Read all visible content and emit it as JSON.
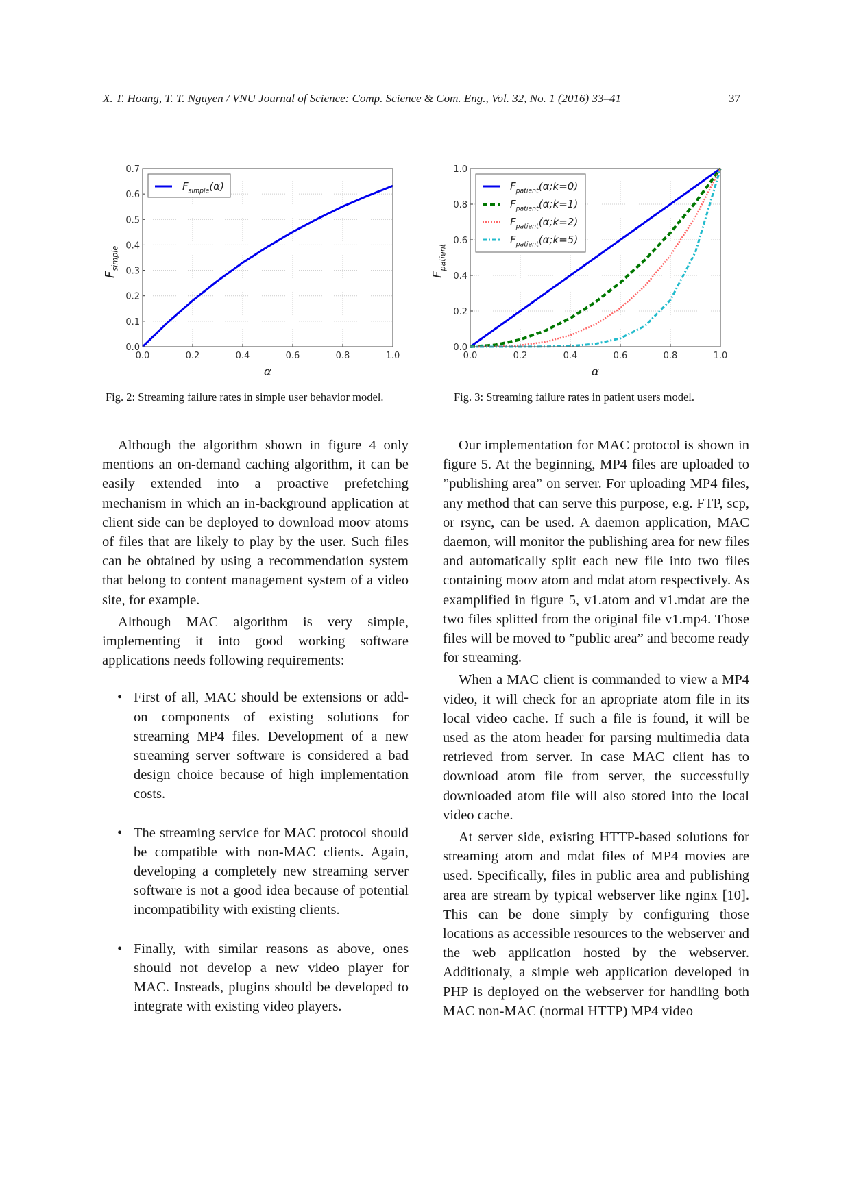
{
  "header": {
    "running_title": "X. T. Hoang, T. T. Nguyen / VNU Journal of Science: Comp. Science & Com. Eng., Vol. 32, No. 1 (2016) 33–41",
    "page_number": "37"
  },
  "captions": {
    "fig2": "Fig. 2: Streaming failure rates in simple user behavior model.",
    "fig3": "Fig. 3: Streaming failure rates in patient users model."
  },
  "chart_data": [
    {
      "type": "line",
      "title": "",
      "xlabel": "α",
      "ylabel": "F_simple",
      "xlim": [
        0.0,
        1.0
      ],
      "ylim": [
        0.0,
        0.7
      ],
      "xticks": [
        "0.0",
        "0.2",
        "0.4",
        "0.6",
        "0.8",
        "1.0"
      ],
      "yticks": [
        "0.0",
        "0.1",
        "0.2",
        "0.3",
        "0.4",
        "0.5",
        "0.6",
        "0.7"
      ],
      "grid": true,
      "legend_position": "top-left",
      "x": [
        0.0,
        0.1,
        0.2,
        0.3,
        0.4,
        0.5,
        0.6,
        0.7,
        0.8,
        0.9,
        1.0
      ],
      "series": [
        {
          "name": "F_simple(α)",
          "color": "#0000ee",
          "style": "solid",
          "values": [
            0.0,
            0.095,
            0.181,
            0.259,
            0.33,
            0.393,
            0.451,
            0.503,
            0.551,
            0.593,
            0.632
          ]
        }
      ]
    },
    {
      "type": "line",
      "title": "",
      "xlabel": "α",
      "ylabel": "F_patient",
      "xlim": [
        0.0,
        1.0
      ],
      "ylim": [
        0.0,
        1.0
      ],
      "xticks": [
        "0.0",
        "0.2",
        "0.4",
        "0.6",
        "0.8",
        "1.0"
      ],
      "yticks": [
        "0.0",
        "0.2",
        "0.4",
        "0.6",
        "0.8",
        "1.0"
      ],
      "grid": true,
      "legend_position": "top-left",
      "x": [
        0.0,
        0.1,
        0.2,
        0.3,
        0.4,
        0.5,
        0.6,
        0.7,
        0.8,
        0.9,
        1.0
      ],
      "series": [
        {
          "name": "F_patient(α;k=0)",
          "color": "#0000ee",
          "style": "solid",
          "values": [
            0.0,
            0.1,
            0.2,
            0.3,
            0.4,
            0.5,
            0.6,
            0.7,
            0.8,
            0.9,
            1.0
          ]
        },
        {
          "name": "F_patient(α;k=1)",
          "color": "#007700",
          "style": "dashed",
          "values": [
            0.0,
            0.01,
            0.04,
            0.09,
            0.16,
            0.25,
            0.36,
            0.49,
            0.64,
            0.81,
            1.0
          ]
        },
        {
          "name": "F_patient(α;k=2)",
          "color": "#ff6666",
          "style": "dotted",
          "values": [
            0.0,
            0.001,
            0.008,
            0.027,
            0.064,
            0.125,
            0.216,
            0.343,
            0.512,
            0.729,
            1.0
          ]
        },
        {
          "name": "F_patient(α;k=5)",
          "color": "#22bbcc",
          "style": "dashdot",
          "values": [
            0.0,
            0.0,
            0.0001,
            0.0007,
            0.004,
            0.016,
            0.047,
            0.118,
            0.262,
            0.531,
            1.0
          ]
        }
      ]
    }
  ],
  "left_column": {
    "paragraphs": [
      "Although the algorithm shown in figure 4 only mentions an on-demand caching algorithm, it can be easily extended into a proactive prefetching mechanism in which an in-background application at client side can be deployed to download moov atoms of files that are likely to play by the user.  Such files can be obtained by using a recommendation system that belong to content management system of a video site, for example.",
      "Although MAC algorithm is very simple, implementing it into good working software applications needs following requirements:"
    ],
    "bullets": [
      "First of all, MAC should be extensions or add-on components of existing solutions for streaming MP4 files.   Development of a new streaming server software is considered a bad design choice because of high implementation costs.",
      "The streaming service for MAC protocol should be compatible with non-MAC clients. Again, developing a completely new streaming server software is not a good idea because of potential incompatibility with existing clients.",
      "Finally, with similar reasons as above, ones should not develop a new video player for MAC. Insteads, plugins should be developed to integrate with existing video players."
    ]
  },
  "right_column": {
    "paragraphs": [
      "Our implementation for MAC protocol is shown in figure 5.   At the beginning, MP4 files are uploaded to ”publishing area” on server. For uploading MP4 files, any method that can serve this purpose, e.g.  FTP, scp, or rsync, can be used.  A daemon application, MAC daemon, will monitor the publishing area for new files and automatically split each new file into two files containing moov atom and mdat atom respectively. As examplified in figure 5, v1.atom and v1.mdat are the two files splitted from the original file v1.mp4.  Those files will be moved to ”public area” and become ready for streaming.",
      "When a MAC client is commanded to view a MP4 video, it will check for an apropriate atom file in its local video cache.  If such a file is found, it will be used as the atom header for parsing multimedia data retrieved from server. In case MAC client has to download atom file from server, the successfully downloaded atom file will also stored into the local video cache.",
      "At server side, existing HTTP-based solutions for streaming atom and mdat files of MP4 movies are used.  Specifically, files in public area and publishing area are stream by typical webserver like nginx [10].   This can be done simply by configuring those locations as accessible resources to the webserver and the web application hosted by the webserver. Additionaly, a simple web application developed in PHP is deployed on the webserver for handling both MAC non-MAC (normal HTTP) MP4 video"
    ]
  }
}
